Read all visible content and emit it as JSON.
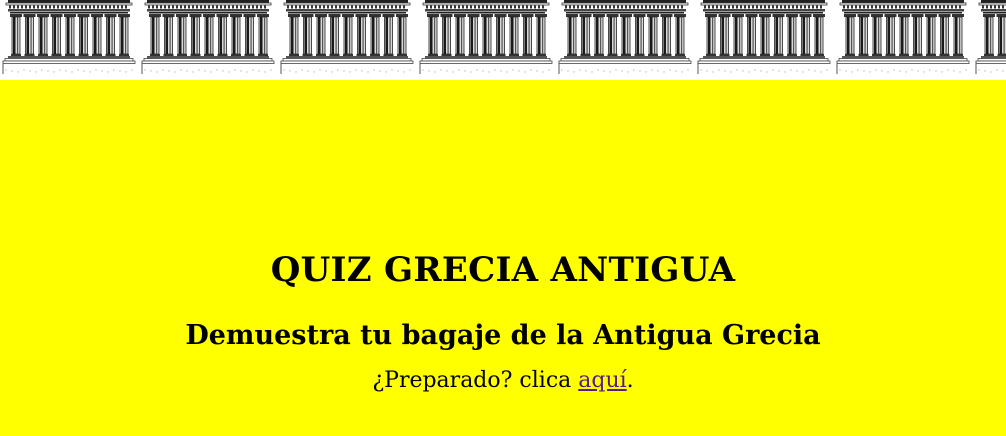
{
  "banner": {
    "temple_icon": "parthenon-icon",
    "temple_count": 8
  },
  "main": {
    "title": "QUIZ GRECIA ANTIGUA",
    "subtitle": "Demuestra tu bagaje de la Antigua Grecia",
    "prompt_prefix": "¿Preparado? clica ",
    "link_text": "aquí",
    "prompt_suffix": "."
  },
  "colors": {
    "background": "#ffff00",
    "banner_background": "#ffffff",
    "link": "#551a8b",
    "text": "#000000"
  }
}
